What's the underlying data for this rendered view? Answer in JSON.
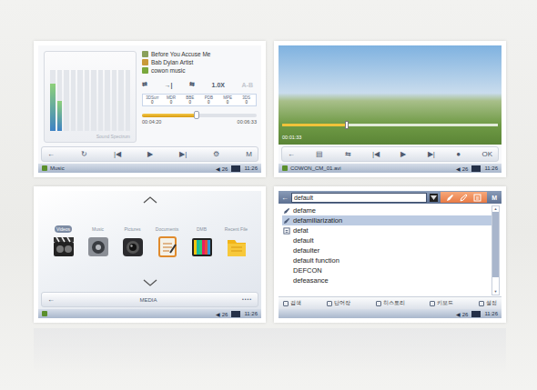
{
  "music": {
    "spectrum": {
      "label": "Sound Spectrum",
      "bands": [
        0.78,
        0.5,
        0,
        0,
        0,
        0,
        0,
        0,
        0,
        0,
        0,
        0
      ]
    },
    "tags": [
      {
        "text": "Before You Accuse Me",
        "color": "#8aa05a"
      },
      {
        "text": "Bab Dylan Artist",
        "color": "#c89a3a"
      },
      {
        "text": "cowon music",
        "color": "#7aa83c"
      }
    ],
    "options": [
      {
        "text": "⇄",
        "active": true
      },
      {
        "text": "→|",
        "active": true
      },
      {
        "text": "⇆",
        "active": true
      },
      {
        "text": "1.0X",
        "active": true
      },
      {
        "text": "A-B",
        "active": false
      }
    ],
    "effects": [
      {
        "name": "3DSurr",
        "value": "0"
      },
      {
        "name": "MDR",
        "value": "0"
      },
      {
        "name": "BBE",
        "value": "0"
      },
      {
        "name": "PDB",
        "value": "0"
      },
      {
        "name": "MPE",
        "value": "0"
      },
      {
        "name": "3DS",
        "value": "0"
      }
    ],
    "progress": {
      "level": 0.48,
      "elapsed": "00:04:20",
      "total": "00:06:33"
    },
    "controls": [
      "←",
      "↻",
      "|◀",
      "▶",
      "▶|",
      "⚙",
      "M"
    ],
    "status": {
      "label": "Music",
      "volume": "26",
      "time": "11:26"
    }
  },
  "video": {
    "progress": {
      "level": 0.3,
      "elapsed": "00:01:33"
    },
    "controls": [
      "←",
      "▤",
      "⇆",
      "|◀",
      "▶",
      "▶|",
      "●",
      "OK"
    ],
    "status": {
      "label": "COWON_CM_01.avi",
      "volume": "26",
      "time": "11:26"
    }
  },
  "media": {
    "items": [
      {
        "label": "Videos",
        "kind": "video",
        "selected": true
      },
      {
        "label": "Music",
        "kind": "music",
        "selected": false
      },
      {
        "label": "Pictures",
        "kind": "camera",
        "selected": false
      },
      {
        "label": "Documents",
        "kind": "document",
        "selected": false
      },
      {
        "label": "DMB",
        "kind": "tv",
        "selected": false
      },
      {
        "label": "Recent File",
        "kind": "folder",
        "selected": false
      }
    ],
    "bar": {
      "back": "←",
      "title": "MEDIA",
      "more": "••••"
    },
    "status": {
      "volume": "26",
      "time": "11:26"
    }
  },
  "dictionary": {
    "back": "←",
    "query": "default",
    "menu": "M",
    "words": [
      {
        "text": "defame",
        "kind": "edit",
        "selected": false
      },
      {
        "text": "defamiliarization",
        "kind": "edit",
        "selected": true
      },
      {
        "text": "defat",
        "kind": "note",
        "selected": false
      },
      {
        "text": "default",
        "kind": "plain",
        "selected": false
      },
      {
        "text": "defaulter",
        "kind": "plain",
        "selected": false
      },
      {
        "text": "default function",
        "kind": "plain",
        "selected": false
      },
      {
        "text": "DEFCON",
        "kind": "plain",
        "selected": false
      },
      {
        "text": "defeasance",
        "kind": "plain",
        "selected": false
      }
    ],
    "scroll": {
      "level": 0.85
    },
    "tabs": [
      "검색",
      "단어장",
      "히스토리",
      "키보드",
      "설정"
    ],
    "status": {
      "volume": "26",
      "time": "11:26"
    }
  }
}
